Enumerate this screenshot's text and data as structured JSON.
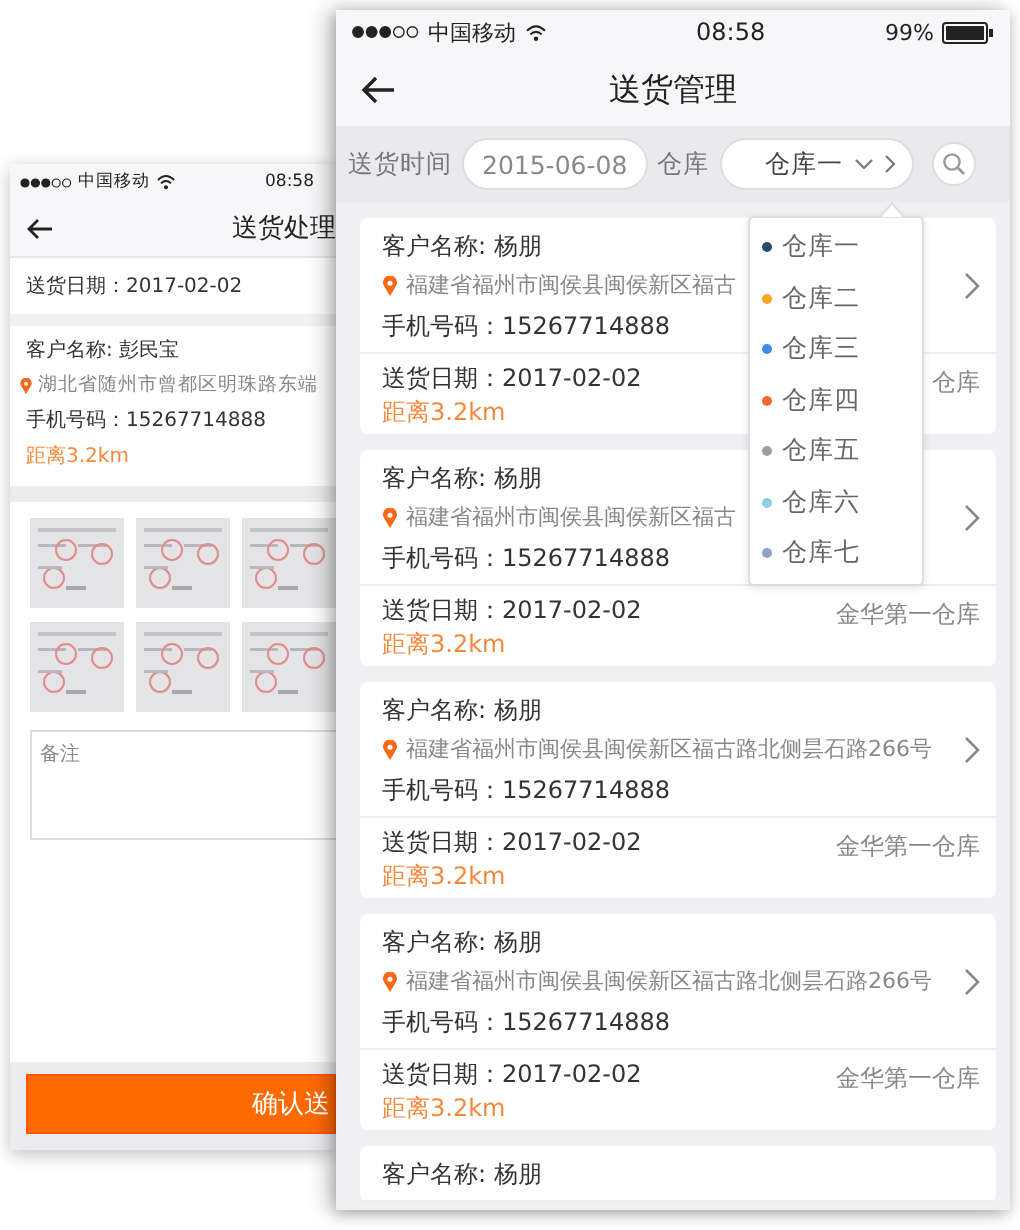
{
  "back_screen": {
    "status_bar": {
      "carrier": "中国移动",
      "time": "08:58"
    },
    "title": "送货处理",
    "delivery_date": "送货日期：2017-02-02",
    "customer": {
      "name": "客户名称:  彭民宝",
      "address": "湖北省随州市曾都区明珠路东端",
      "phone": "手机号码：15267714888",
      "distance": "距离3.2km"
    },
    "note": {
      "placeholder": "备注"
    },
    "confirm_button": "确认送"
  },
  "front_screen": {
    "status_bar": {
      "carrier": "中国移动",
      "time": "08:58",
      "battery": "99%"
    },
    "title": "送货管理",
    "filter": {
      "date_label": "送货时间",
      "date": "2015-06-08",
      "warehouse_label": "仓库",
      "warehouse": "仓库一",
      "warehouse_menu": [
        {
          "label": "仓库一",
          "color": "#2c4a63"
        },
        {
          "label": "仓库二",
          "color": "#f5a623"
        },
        {
          "label": "仓库三",
          "color": "#3a8ee6"
        },
        {
          "label": "仓库四",
          "color": "#f56a2a"
        },
        {
          "label": "仓库五",
          "color": "#a39e98"
        },
        {
          "label": "仓库六",
          "color": "#8fd1e0"
        },
        {
          "label": "仓库七",
          "color": "#8ea4c0"
        }
      ]
    },
    "orders": [
      {
        "customer": "客户名称: 杨朋",
        "address": "福建省福州市闽侯县闽侯新区福古",
        "phone": "手机号码：15267714888",
        "date": "送货日期：2017-02-02",
        "distance": "距离3.2km",
        "warehouse": "仓库"
      },
      {
        "customer": "客户名称: 杨朋",
        "address": "福建省福州市闽侯县闽侯新区福古",
        "phone": "手机号码：15267714888",
        "date": "送货日期：2017-02-02",
        "distance": "距离3.2km",
        "warehouse": "金华第一仓库"
      },
      {
        "customer": "客户名称: 杨朋",
        "address": "福建省福州市闽侯县闽侯新区福古路北侧昙石路266号",
        "phone": "手机号码：15267714888",
        "date": "送货日期：2017-02-02",
        "distance": "距离3.2km",
        "warehouse": "金华第一仓库"
      },
      {
        "customer": "客户名称: 杨朋",
        "address": "福建省福州市闽侯县闽侯新区福古路北侧昙石路266号",
        "phone": "手机号码：15267714888",
        "date": "送货日期：2017-02-02",
        "distance": "距离3.2km",
        "warehouse": "金华第一仓库"
      },
      {
        "customer": "客户名称: 杨朋"
      }
    ]
  }
}
